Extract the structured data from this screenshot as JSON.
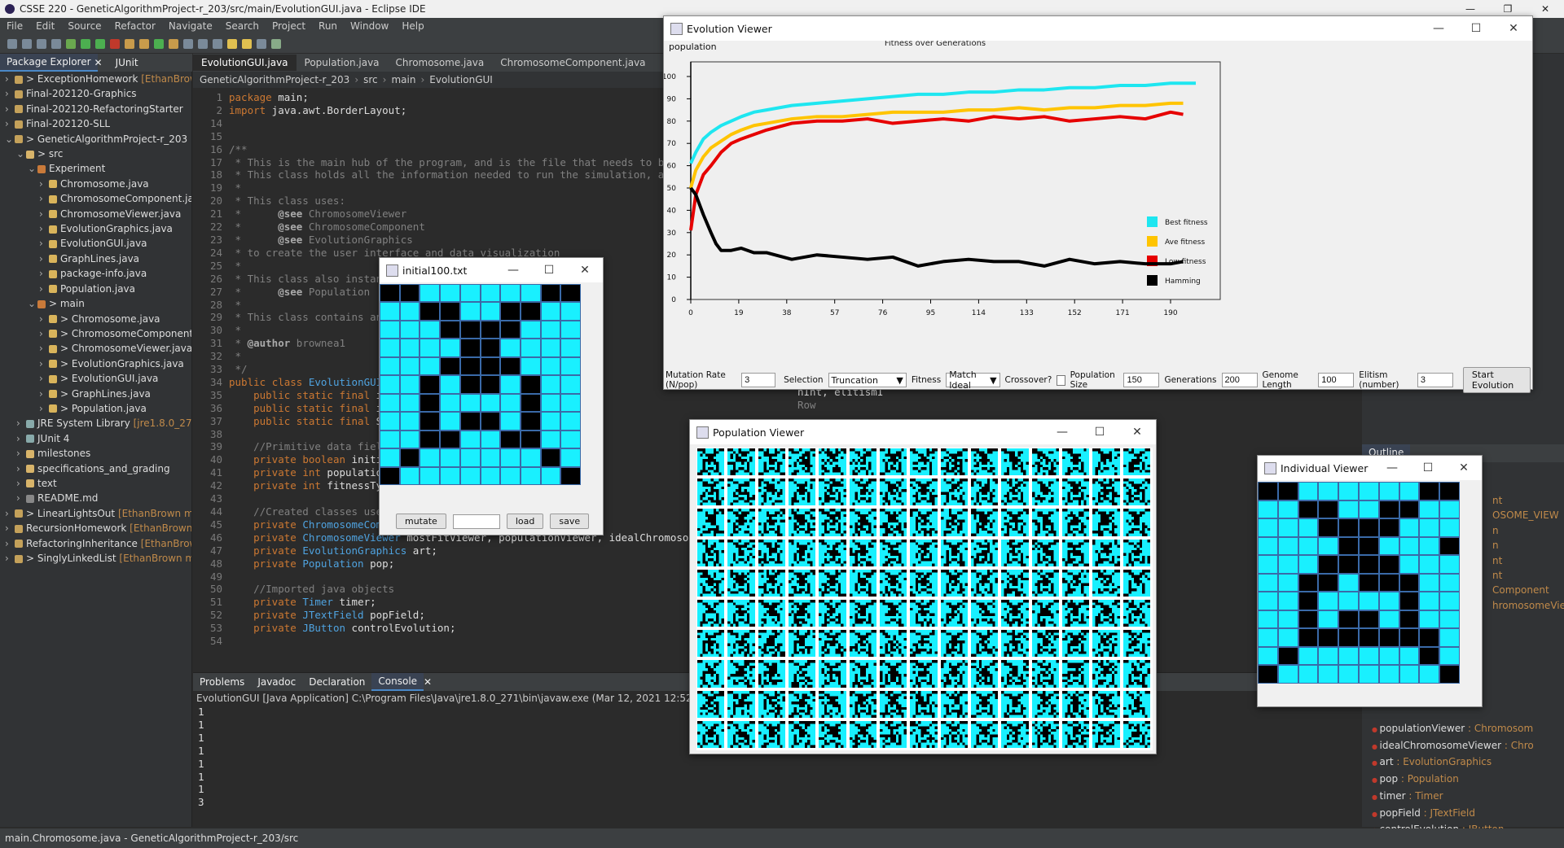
{
  "window_title": "CSSE 220 - GeneticAlgorithmProject-r_203/src/main/EvolutionGUI.java - Eclipse IDE",
  "menu": [
    "File",
    "Edit",
    "Source",
    "Refactor",
    "Navigate",
    "Search",
    "Project",
    "Run",
    "Window",
    "Help"
  ],
  "explorer": {
    "tabs": [
      "Package Explorer",
      "JUnit"
    ],
    "items": [
      {
        "label": "> ExceptionHomework",
        "repo": "[EthanBrown",
        "indent": 0,
        "icon": "proj",
        "open": false
      },
      {
        "label": "Final-202120-Graphics",
        "repo": "",
        "indent": 0,
        "icon": "proj",
        "open": false
      },
      {
        "label": "Final-202120-RefactoringStarter",
        "repo": "",
        "indent": 0,
        "icon": "proj",
        "open": false
      },
      {
        "label": "Final-202120-SLL",
        "repo": "",
        "indent": 0,
        "icon": "proj",
        "open": false
      },
      {
        "label": "> GeneticAlgorithmProject-r_203",
        "repo": "[cs",
        "indent": 0,
        "icon": "proj",
        "open": true
      },
      {
        "label": "> src",
        "repo": "",
        "indent": 1,
        "icon": "fold",
        "open": true
      },
      {
        "label": "Experiment",
        "repo": "",
        "indent": 2,
        "icon": "pkgic",
        "open": true
      },
      {
        "label": "Chromosome.java",
        "repo": "",
        "indent": 3,
        "icon": "jfile",
        "open": false
      },
      {
        "label": "ChromosomeComponent.ja",
        "repo": "",
        "indent": 3,
        "icon": "jfile",
        "open": false
      },
      {
        "label": "ChromosomeViewer.java",
        "repo": "",
        "indent": 3,
        "icon": "jfile",
        "open": false
      },
      {
        "label": "EvolutionGraphics.java",
        "repo": "",
        "indent": 3,
        "icon": "jfile",
        "open": false
      },
      {
        "label": "EvolutionGUI.java",
        "repo": "",
        "indent": 3,
        "icon": "jfile",
        "open": false
      },
      {
        "label": "GraphLines.java",
        "repo": "",
        "indent": 3,
        "icon": "jfile",
        "open": false
      },
      {
        "label": "package-info.java",
        "repo": "",
        "indent": 3,
        "icon": "jfile",
        "open": false
      },
      {
        "label": "Population.java",
        "repo": "",
        "indent": 3,
        "icon": "jfile",
        "open": false
      },
      {
        "label": "> main",
        "repo": "",
        "indent": 2,
        "icon": "pkgic",
        "open": true
      },
      {
        "label": "> Chromosome.java",
        "repo": "",
        "indent": 3,
        "icon": "jfile",
        "open": false
      },
      {
        "label": "> ChromosomeComponent",
        "repo": "",
        "indent": 3,
        "icon": "jfile",
        "open": false
      },
      {
        "label": "> ChromosomeViewer.java",
        "repo": "",
        "indent": 3,
        "icon": "jfile",
        "open": false
      },
      {
        "label": "> EvolutionGraphics.java",
        "repo": "",
        "indent": 3,
        "icon": "jfile",
        "open": false
      },
      {
        "label": "> EvolutionGUI.java",
        "repo": "",
        "indent": 3,
        "icon": "jfile",
        "open": false
      },
      {
        "label": "> GraphLines.java",
        "repo": "",
        "indent": 3,
        "icon": "jfile",
        "open": false
      },
      {
        "label": "> Population.java",
        "repo": "",
        "indent": 3,
        "icon": "jfile",
        "open": false
      },
      {
        "label": "JRE System Library",
        "repo": "[jre1.8.0_271]",
        "indent": 1,
        "icon": "lib",
        "open": false
      },
      {
        "label": "JUnit 4",
        "repo": "",
        "indent": 1,
        "icon": "lib",
        "open": false
      },
      {
        "label": "milestones",
        "repo": "",
        "indent": 1,
        "icon": "fold",
        "open": false
      },
      {
        "label": "specifications_and_grading",
        "repo": "",
        "indent": 1,
        "icon": "fold",
        "open": false
      },
      {
        "label": "text",
        "repo": "",
        "indent": 1,
        "icon": "fold",
        "open": false
      },
      {
        "label": "README.md",
        "repo": "",
        "indent": 1,
        "icon": "mdf",
        "open": false
      },
      {
        "label": "> LinearLightsOut",
        "repo": "[EthanBrown mast",
        "indent": 0,
        "icon": "proj",
        "open": false
      },
      {
        "label": "RecursionHomework",
        "repo": "[EthanBrown m",
        "indent": 0,
        "icon": "proj",
        "open": false
      },
      {
        "label": "RefactoringInheritance",
        "repo": "[EthanBrown",
        "indent": 0,
        "icon": "proj",
        "open": false
      },
      {
        "label": "> SinglyLinkedList",
        "repo": "[EthanBrown mast",
        "indent": 0,
        "icon": "proj",
        "open": false
      }
    ]
  },
  "editor": {
    "tabs": [
      "EvolutionGUI.java",
      "Population.java",
      "Chromosome.java",
      "ChromosomeComponent.java"
    ],
    "breadcrumb": [
      "GeneticAlgorithmProject-r_203",
      "src",
      "main",
      "EvolutionGUI"
    ],
    "lines": [
      {
        "n": "1",
        "t": "package main;"
      },
      {
        "n": "2",
        "t": "import java.awt.BorderLayout;"
      },
      {
        "n": "14",
        "t": ""
      },
      {
        "n": "15",
        "t": ""
      },
      {
        "n": "16",
        "t": "/**"
      },
      {
        "n": "17",
        "t": " * This is the main hub of the program, and is the file that needs to be r"
      },
      {
        "n": "18",
        "t": " * This class holds all the information needed to run the simulation, and"
      },
      {
        "n": "19",
        "t": " *"
      },
      {
        "n": "20",
        "t": " * This class uses:"
      },
      {
        "n": "21",
        "t": " *      @see ChromosomeViewer"
      },
      {
        "n": "22",
        "t": " *      @see ChromosomeComponent"
      },
      {
        "n": "23",
        "t": " *      @see EvolutionGraphics"
      },
      {
        "n": "24",
        "t": " * to create the user interface and data visualization"
      },
      {
        "n": "25",
        "t": " *"
      },
      {
        "n": "26",
        "t": " * This class also instan"
      },
      {
        "n": "27",
        "t": " *      @see Population"
      },
      {
        "n": "28",
        "t": " *"
      },
      {
        "n": "29",
        "t": " * This class contains an"
      },
      {
        "n": "30",
        "t": " *"
      },
      {
        "n": "31",
        "t": " * @author brownea1"
      },
      {
        "n": "32",
        "t": " *"
      },
      {
        "n": "33",
        "t": " */"
      },
      {
        "n": "34",
        "t": "public class EvolutionGUI"
      },
      {
        "n": "35",
        "t": "    public static final i"
      },
      {
        "n": "36",
        "t": "    public static final i"
      },
      {
        "n": "37",
        "t": "    public static final S"
      },
      {
        "n": "38",
        "t": ""
      },
      {
        "n": "39",
        "t": "    //Primitive data fiel"
      },
      {
        "n": "40",
        "t": "    private boolean initi"
      },
      {
        "n": "41",
        "t": "    private int populatio"
      },
      {
        "n": "42",
        "t": "    private int fitnessTy"
      },
      {
        "n": "43",
        "t": ""
      },
      {
        "n": "44",
        "t": "    //Created classes use"
      },
      {
        "n": "45",
        "t": "    private ChromosomeCom"
      },
      {
        "n": "46",
        "t": "    private ChromosomeViewer mostFitViewer, populationViewer, idealChromosomeVi"
      },
      {
        "n": "47",
        "t": "    private EvolutionGraphics art;"
      },
      {
        "n": "48",
        "t": "    private Population pop;"
      },
      {
        "n": "49",
        "t": ""
      },
      {
        "n": "50",
        "t": "    //Imported java objects"
      },
      {
        "n": "51",
        "t": "    private Timer timer;"
      },
      {
        "n": "52",
        "t": "    private JTextField popField;"
      },
      {
        "n": "53",
        "t": "    private JButton controlEvolution;"
      },
      {
        "n": "54",
        "t": ""
      }
    ],
    "fragments": {
      "f28": "when a JB",
      "f37": "\"initial100.tx",
      "f40": "= false;",
      "f41": "nInt, elitismI",
      "f42": "Row"
    }
  },
  "console": {
    "tabs": [
      "Problems",
      "Javadoc",
      "Declaration",
      "Console"
    ],
    "header": "EvolutionGUI [Java Application] C:\\Program Files\\Java\\jre1.8.0_271\\bin\\javaw.exe  (Mar 12, 2021 12:52:50 PM)",
    "lines": [
      "1",
      "1",
      "1",
      "1",
      "1",
      "1",
      "1",
      "3"
    ]
  },
  "outline": {
    "tab": "Outline",
    "items": [
      {
        "label": "populationViewer",
        "type": ": Chromosom"
      },
      {
        "label": "idealChromosomeViewer",
        "type": ": Chro"
      },
      {
        "label": "art",
        "type": ": EvolutionGraphics"
      },
      {
        "label": "pop",
        "type": ": Population"
      },
      {
        "label": "timer",
        "type": ": Timer"
      },
      {
        "label": "popField",
        "type": ": JTextField"
      },
      {
        "label": "controlEvolution",
        "type": ": JButton"
      }
    ],
    "partial": [
      "nt",
      "OSOME_VIEW",
      "n",
      "n",
      "nt",
      "nt",
      "Component",
      "hromosomeVie"
    ]
  },
  "status": "main.Chromosome.java - GeneticAlgorithmProject-r_203/src",
  "evolution_viewer": {
    "title": "Evolution Viewer",
    "population_label": "population",
    "controls": {
      "mutation_label": "Mutation Rate (N/pop)",
      "mutation_value": "3",
      "selection_label": "Selection",
      "selection_value": "Truncation",
      "fitness_label": "Fitness",
      "fitness_value": "Match Ideal",
      "crossover_label": "Crossover?",
      "popsize_label": "Population Size",
      "popsize_value": "150",
      "generations_label": "Generations",
      "generations_value": "200",
      "genome_label": "Genome Length",
      "genome_value": "100",
      "elitism_label": "Elitism (number)",
      "elitism_value": "3",
      "start_label": "Start Evolution"
    }
  },
  "chart_data": {
    "type": "line",
    "title": "Fitness over Generations",
    "xlim": [
      0,
      200
    ],
    "ylim": [
      0,
      100
    ],
    "x_ticks": [
      0,
      19,
      38,
      57,
      76,
      95,
      114,
      133,
      152,
      171,
      190
    ],
    "y_ticks": [
      0,
      10,
      20,
      30,
      40,
      50,
      60,
      70,
      80,
      90,
      100
    ],
    "legend_position": "right",
    "series": [
      {
        "name": "Best fitness",
        "color": "#1ee6f0",
        "x": [
          0,
          2,
          5,
          8,
          12,
          16,
          20,
          25,
          30,
          40,
          50,
          60,
          70,
          80,
          90,
          100,
          110,
          120,
          130,
          140,
          150,
          160,
          170,
          180,
          190,
          200
        ],
        "y": [
          61,
          66,
          72,
          75,
          78,
          80,
          82,
          84,
          85,
          87,
          88,
          89,
          90,
          91,
          92,
          92,
          93,
          93,
          94,
          94,
          95,
          95,
          96,
          96,
          97,
          97
        ]
      },
      {
        "name": "Ave fitness",
        "color": "#ffc400",
        "x": [
          0,
          2,
          5,
          8,
          12,
          16,
          20,
          25,
          30,
          40,
          50,
          60,
          70,
          80,
          90,
          100,
          110,
          120,
          130,
          140,
          150,
          160,
          170,
          180,
          190,
          195
        ],
        "y": [
          50,
          58,
          64,
          68,
          71,
          74,
          76,
          78,
          79,
          81,
          82,
          82,
          83,
          84,
          84,
          84,
          85,
          85,
          86,
          85,
          86,
          86,
          87,
          87,
          88,
          88
        ]
      },
      {
        "name": "Low fitness",
        "color": "#e60000",
        "x": [
          0,
          2,
          5,
          8,
          12,
          16,
          20,
          25,
          30,
          40,
          50,
          60,
          70,
          80,
          90,
          100,
          110,
          120,
          130,
          140,
          150,
          160,
          170,
          180,
          190,
          195
        ],
        "y": [
          31,
          47,
          56,
          60,
          66,
          70,
          72,
          74,
          76,
          79,
          80,
          80,
          81,
          79,
          80,
          81,
          80,
          82,
          81,
          82,
          80,
          81,
          82,
          81,
          84,
          83
        ]
      },
      {
        "name": "Hamming",
        "color": "#000000",
        "x": [
          0,
          2,
          5,
          8,
          10,
          12,
          16,
          20,
          25,
          30,
          40,
          50,
          60,
          70,
          80,
          90,
          100,
          110,
          120,
          130,
          140,
          150,
          160,
          170,
          180,
          190,
          195
        ],
        "y": [
          50,
          47,
          38,
          30,
          25,
          22,
          22,
          23,
          21,
          21,
          18,
          20,
          19,
          18,
          19,
          15,
          17,
          18,
          17,
          17,
          15,
          18,
          16,
          17,
          16,
          16,
          17
        ]
      }
    ]
  },
  "initial_window": {
    "title": "initial100.txt",
    "mutate_label": "mutate",
    "load_label": "load",
    "save_label": "save",
    "grid": [
      "1100000011",
      "0011001100",
      "0001111000",
      "0000110000",
      "0001111000",
      "0010110100",
      "0010000100",
      "0010110100",
      "0011001100",
      "0100000010",
      "1000000001"
    ]
  },
  "population_viewer": {
    "title": "Population Viewer",
    "cols": 15,
    "rows": 10
  },
  "individual_viewer": {
    "title": "Individual Viewer",
    "grid": [
      "1100000011",
      "0011001100",
      "0001111000",
      "0000110001",
      "0001111000",
      "0011011100",
      "0010000100",
      "0010110100",
      "0011111110",
      "0100000010",
      "1000000001"
    ]
  }
}
